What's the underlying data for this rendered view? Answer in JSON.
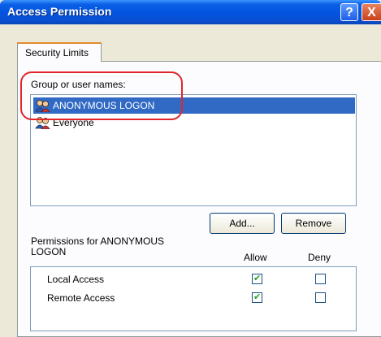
{
  "window": {
    "title": "Access Permission",
    "help_glyph": "?",
    "close_glyph": "X"
  },
  "tabs": [
    {
      "label": "Security Limits"
    }
  ],
  "group_list": {
    "label": "Group or user names:",
    "items": [
      {
        "name": "ANONYMOUS LOGON",
        "selected": true,
        "icon": "users-icon"
      },
      {
        "name": "Everyone",
        "selected": false,
        "icon": "users-icon"
      }
    ]
  },
  "buttons": {
    "add": "Add...",
    "remove": "Remove"
  },
  "permissions": {
    "label": "Permissions for ANONYMOUS LOGON",
    "col_allow": "Allow",
    "col_deny": "Deny",
    "rows": [
      {
        "label": "Local Access",
        "allow": true,
        "deny": false
      },
      {
        "label": "Remote Access",
        "allow": true,
        "deny": false
      }
    ]
  },
  "colors": {
    "title_bar": "#0254e0",
    "selection": "#316ac5",
    "annotation": "#e0262a"
  }
}
